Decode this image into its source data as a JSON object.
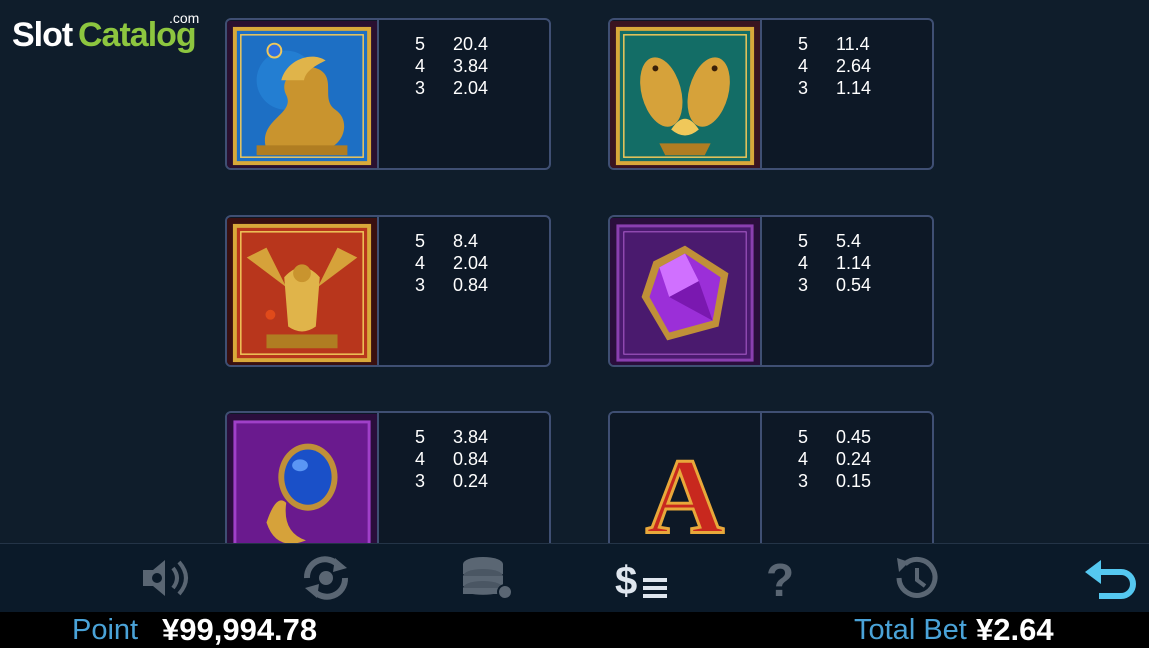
{
  "logo": {
    "slot": "Slot",
    "catalog": "Catalog",
    "dotcom": ".com"
  },
  "paytable": [
    {
      "symbol": "golden-dragon",
      "rows": [
        {
          "count": "5",
          "value": "20.4"
        },
        {
          "count": "4",
          "value": "3.84"
        },
        {
          "count": "3",
          "value": "2.04"
        }
      ]
    },
    {
      "symbol": "golden-koi-fish",
      "rows": [
        {
          "count": "5",
          "value": "11.4"
        },
        {
          "count": "4",
          "value": "2.64"
        },
        {
          "count": "3",
          "value": "1.14"
        }
      ]
    },
    {
      "symbol": "golden-phoenix",
      "rows": [
        {
          "count": "5",
          "value": "8.4"
        },
        {
          "count": "4",
          "value": "2.04"
        },
        {
          "count": "3",
          "value": "0.84"
        }
      ]
    },
    {
      "symbol": "purple-gem",
      "rows": [
        {
          "count": "5",
          "value": "5.4"
        },
        {
          "count": "4",
          "value": "1.14"
        },
        {
          "count": "3",
          "value": "0.54"
        }
      ]
    },
    {
      "symbol": "sapphire-ring",
      "rows": [
        {
          "count": "5",
          "value": "3.84"
        },
        {
          "count": "4",
          "value": "0.84"
        },
        {
          "count": "3",
          "value": "0.24"
        }
      ]
    },
    {
      "symbol": "letter-a",
      "rows": [
        {
          "count": "5",
          "value": "0.45"
        },
        {
          "count": "4",
          "value": "0.24"
        },
        {
          "count": "3",
          "value": "0.15"
        }
      ],
      "letter": "A"
    }
  ],
  "toolbar": {
    "buttons": [
      "sound-settings-icon",
      "autoplay-settings-icon",
      "bet-chips-icon",
      "paytable-icon",
      "help-icon",
      "history-icon",
      "back-icon"
    ]
  },
  "footer": {
    "point_label": "Point",
    "point_value": "¥99,994.78",
    "total_bet_label": "Total Bet",
    "total_bet_value": "¥2.64"
  },
  "colors": {
    "background": "#0f1d2b",
    "card_border": "#3f4f73",
    "label_blue": "#4aa3d8",
    "back_icon": "#55c8f0",
    "toolbar_icon": "#5a6673"
  }
}
